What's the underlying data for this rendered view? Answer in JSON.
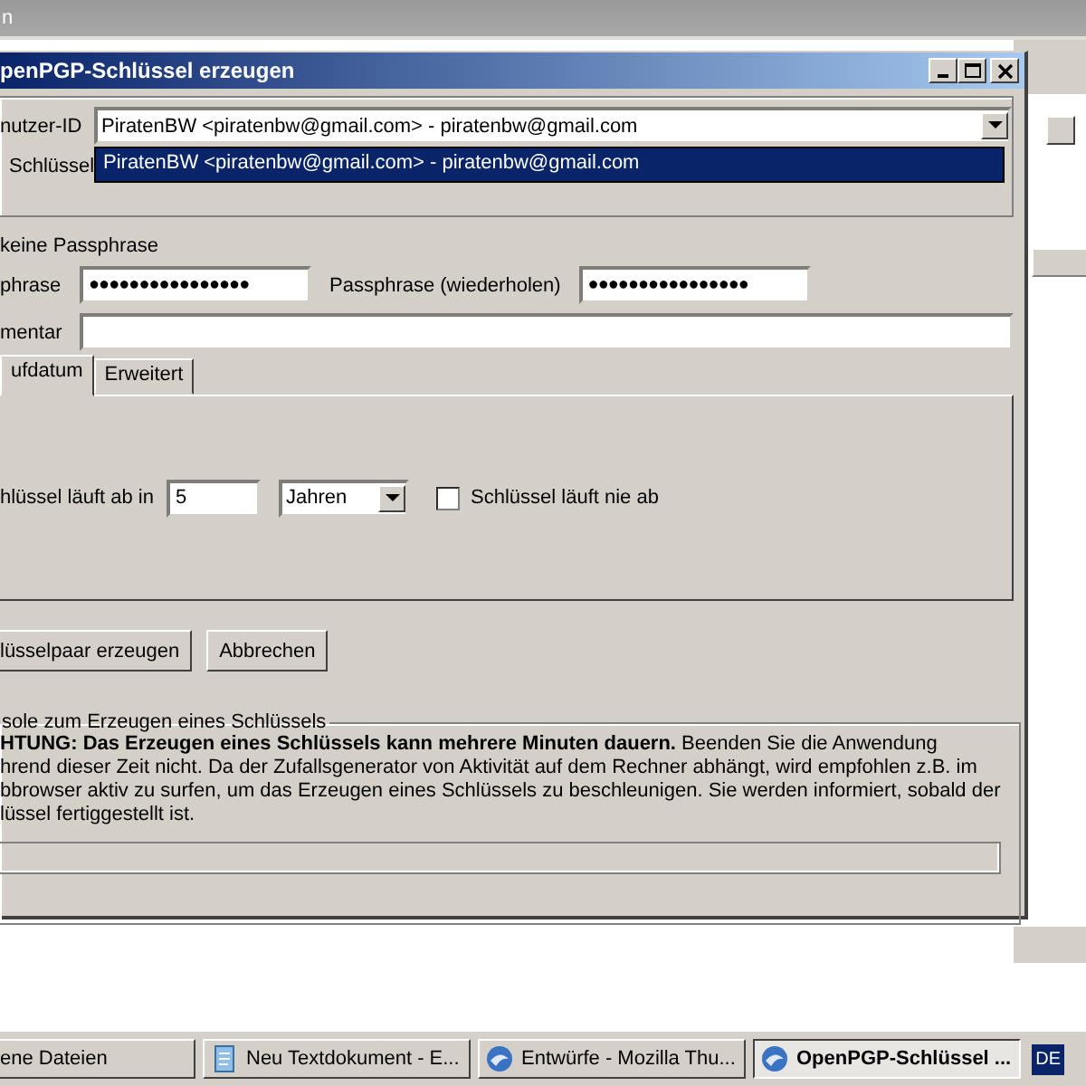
{
  "background_window": {
    "title": "n"
  },
  "dialog": {
    "title": "penPGP-Schlüssel erzeugen",
    "user_id": {
      "label": "nutzer-ID",
      "value": "PiratenBW <piratenbw@gmail.com> - piratenbw@gmail.com",
      "options": [
        {
          "text": "PiratenBW <piratenbw@gmail.com> - piratenbw@gmail.com",
          "selected": true
        }
      ]
    },
    "key_label": "Schlüssel",
    "no_passphrase_label": "keine Passphrase",
    "passphrase": {
      "label": "phrase",
      "value": "●●●●●●●●●●●●●●●●"
    },
    "passphrase_repeat": {
      "label": "Passphrase (wiederholen)",
      "value": "●●●●●●●●●●●●●●●●"
    },
    "comment": {
      "label": "mentar"
    },
    "tabs": [
      {
        "label": "ufdatum",
        "selected": true
      },
      {
        "label": "Erweitert",
        "selected": false
      }
    ],
    "expiry": {
      "label": "hlüssel läuft ab in",
      "value": "5",
      "unit": "Jahren",
      "never": {
        "label": "Schlüssel läuft nie ab",
        "checked": false
      }
    },
    "buttons": [
      "lüsselpaar erzeugen",
      "Abbrechen"
    ],
    "console": {
      "legend": "sole zum Erzeugen eines Schlüssels",
      "lines": [
        "**HTUNG: Das Erzeugen eines Schlüssels kann mehrere Minuten dauern.** Beenden Sie die Anwendung",
        "hrend dieser Zeit nicht. Da der Zufallsgenerator von Aktivität auf dem Rechner abhängt, wird empfohlen z.B. im",
        "bbrowser aktiv zu surfen, um das Erzeugen eines Schlüssels zu beschleunigen. Sie werden informiert, sobald der",
        "lüssel fertiggestellt ist."
      ],
      "progress": {
        "level": 0
      }
    }
  },
  "taskbar": {
    "items": [
      {
        "label": "ene Dateien",
        "kind": "plain",
        "selected": false
      },
      {
        "label": "Neu Textdokument - E...",
        "kind": "notepad",
        "selected": false
      },
      {
        "label": "Entwürfe - Mozilla Thu...",
        "kind": "mail",
        "selected": false
      },
      {
        "label": "OpenPGP-Schlüssel ...",
        "kind": "mail",
        "selected": true
      }
    ],
    "language": "DE"
  }
}
